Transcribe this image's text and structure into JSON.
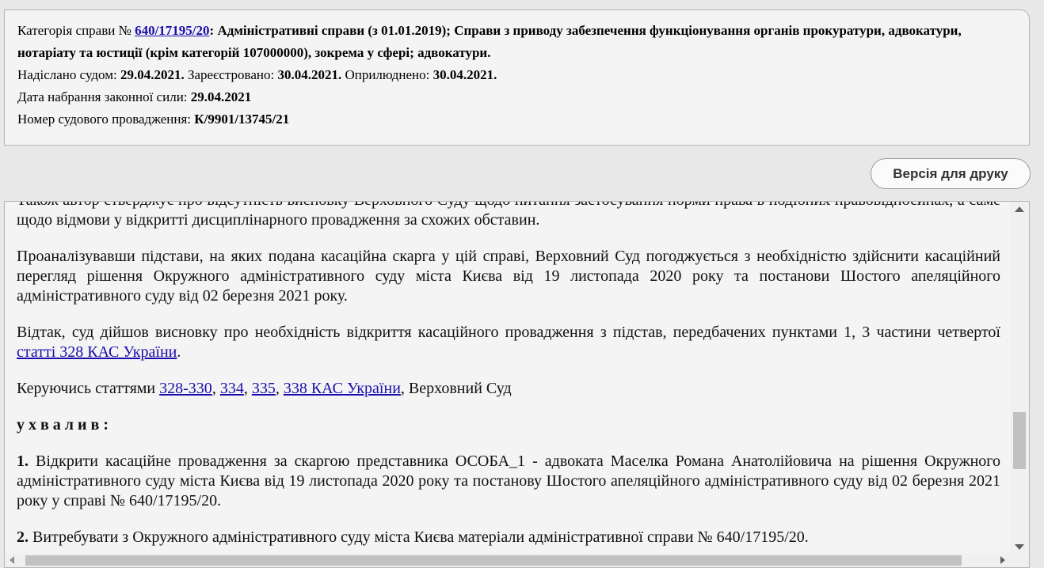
{
  "info": {
    "category_prefix": "Категорія справи № ",
    "case_number": "640/17195/20",
    "category_text": ": Адміністративні справи (з 01.01.2019); Справи з приводу забезпечення функціонування органів прокуратури, адвокатури, нотаріату та юстиції (крім категорій 107000000), зокрема у сфері; адвокатури.",
    "sent_label": "Надіслано судом: ",
    "sent_date": "29.04.2021.",
    "registered_label": " Зареєстровано: ",
    "registered_date": "30.04.2021.",
    "published_label": " Оприлюднено: ",
    "published_date": "30.04.2021.",
    "effective_label": "Дата набрання законної сили: ",
    "effective_date": "29.04.2021",
    "proceeding_label": "Номер судового провадження: ",
    "proceeding_number": "К/9901/13745/21"
  },
  "toolbar": {
    "print_label": "Версія для друку"
  },
  "document": {
    "p1": "Також автор стверджує про відсутність висновку Верховного Суду щодо питання застосування норми права в подібних правовідносинах, а саме щодо відмови у відкритті дисциплінарного провадження за схожих обставин.",
    "p2": "Проаналізувавши підстави, на яких подана касаційна скарга у цій справі, Верховний Суд погоджується з необхідністю здійснити касаційний перегляд рішення Окружного адміністративного суду міста Києва від 19 листопада 2020 року та постанови Шостого апеляційного адміністративного суду від 02 березня 2021 року.",
    "p3_text": "Відтак, суд дійшов висновку про необхідність відкриття касаційного провадження з підстав, передбачених пунктами 1, 3 частини четвертої ",
    "p3_link": "статті 328 КАС України",
    "p3_end": ".",
    "p4_text": "Керуючись статтями ",
    "p4_link1": "328-330",
    "p4_sep1": ", ",
    "p4_link2": "334",
    "p4_sep2": ", ",
    "p4_link3": "335",
    "p4_sep3": ", ",
    "p4_link4": "338 КАС України",
    "p4_end": ", Верховний Суд",
    "heading": "у х в а л и в :",
    "item1_num": "1.",
    "item1_text": " Відкрити касаційне провадження за скаргою представника ОСОБА_1 - адвоката Маселка Романа Анатолійовича на рішення Окружного адміністративного суду міста Києва від 19 листопада 2020 року та постанову Шостого апеляційного адміністративного суду від 02 березня 2021 року у справі № 640/17195/20.",
    "item2_num": "2.",
    "item2_text": " Витребувати з Окружного адміністративного суду міста Києва матеріали адміністративної справи № 640/17195/20."
  },
  "colors": {
    "link": "#1a0dab",
    "panel_bg": "#f4f4f4",
    "page_bg": "#e8e8e8"
  }
}
